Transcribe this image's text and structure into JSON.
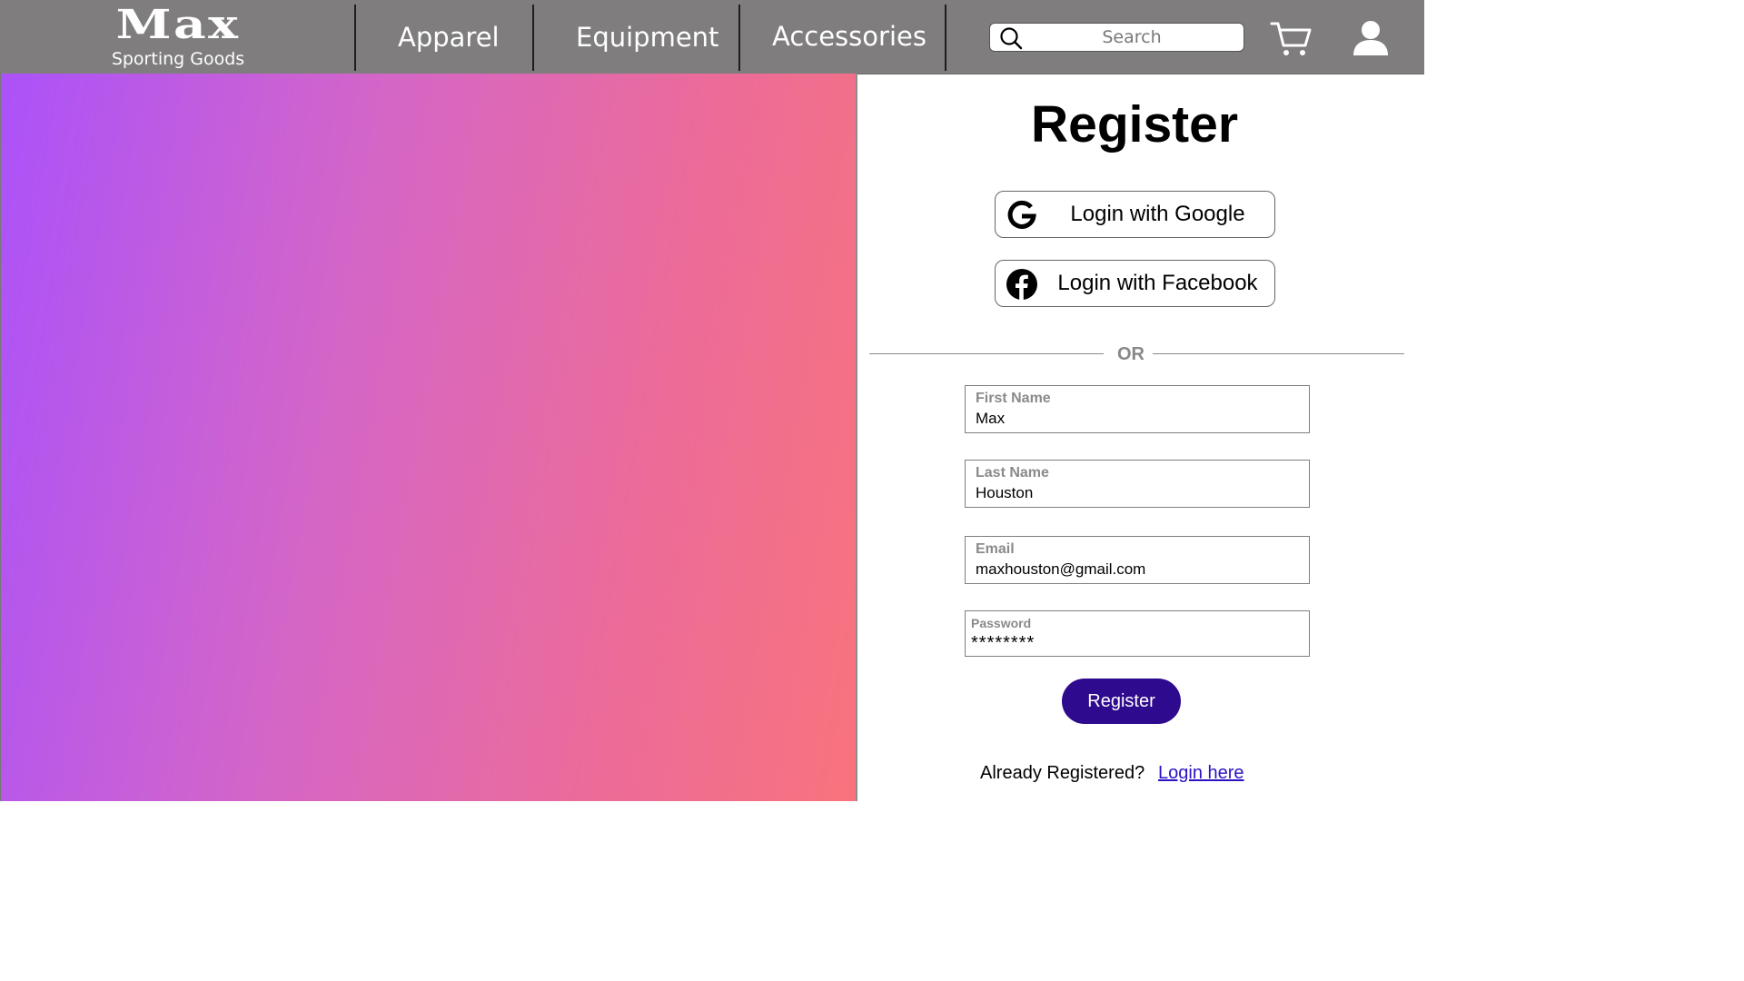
{
  "header": {
    "logo": {
      "name": "Max",
      "tagline": "Sporting Goods"
    },
    "nav": [
      {
        "label": "Apparel"
      },
      {
        "label": "Equipment"
      },
      {
        "label": "Accessories"
      }
    ],
    "search": {
      "placeholder": "Search",
      "icon": "search-icon"
    },
    "cart_icon": "cart-icon",
    "account_icon": "user-icon",
    "background_color": "#7f7d7e"
  },
  "hero": {
    "gradient_colors": [
      "#ab52fa",
      "#d566c6",
      "#eb6b9a",
      "#f9737d"
    ]
  },
  "register": {
    "title": "Register",
    "google_button": "Login with Google",
    "facebook_button": "Login with Facebook",
    "divider_text": "OR",
    "fields": {
      "first_name": {
        "label": "First Name",
        "value": "Max"
      },
      "last_name": {
        "label": "Last Name",
        "value": "Houston"
      },
      "email": {
        "label": "Email",
        "value": "maxhouston@gmail.com"
      },
      "password": {
        "label": "Password",
        "value": "********"
      }
    },
    "submit_label": "Register",
    "submit_color": "#2e0a8e",
    "already_text": "Already Registered?",
    "login_link": "Login here",
    "link_color": "#2a13c4"
  }
}
